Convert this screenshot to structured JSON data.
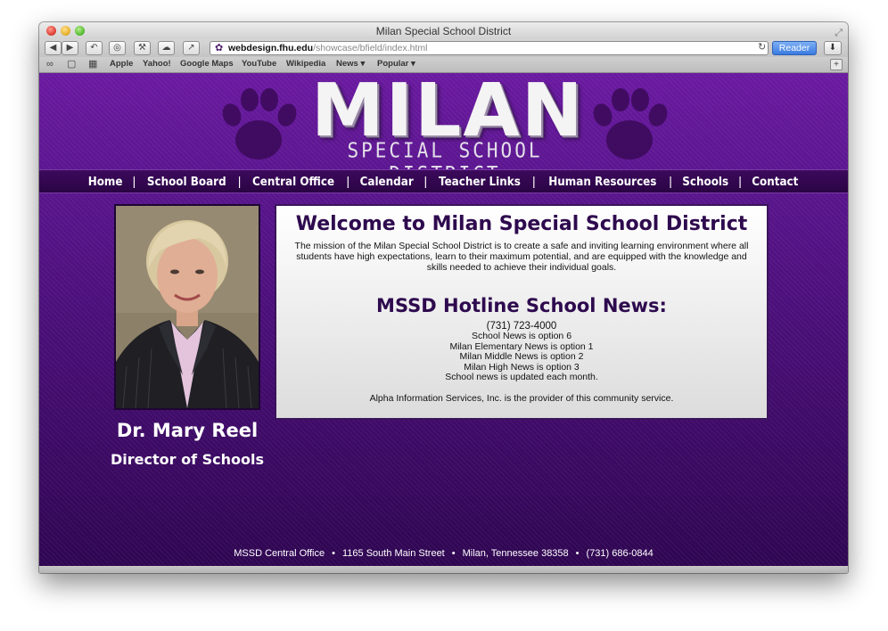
{
  "window": {
    "title": "Milan Special School District"
  },
  "toolbar": {
    "url_host": "webdesign.fhu.edu",
    "url_path": "/showcase/bfield/index.html",
    "reader_label": "Reader"
  },
  "bookmarks": {
    "items": [
      "Apple",
      "Yahoo!",
      "Google Maps",
      "YouTube",
      "Wikipedia",
      "News ▾",
      "Popular ▾"
    ]
  },
  "logo": {
    "main": "MILAN",
    "sub": "SPECIAL SCHOOL DISTRICT"
  },
  "nav": {
    "items": [
      "Home",
      "School Board",
      "Central Office",
      "Calendar",
      "Teacher Links",
      "Human Resources",
      "Schools",
      "Contact"
    ],
    "separator": "|"
  },
  "director": {
    "name": "Dr. Mary Reel",
    "role": "Director of Schools"
  },
  "content": {
    "welcome": "Welcome to Milan Special School District",
    "mission": "The mission of the Milan Special School District is to create a safe and inviting learning environment where all students have high expectations, learn to their maximum potential, and are equipped with the knowledge and skills needed to achieve their individual goals.",
    "hotline_title": "MSSD Hotline School News:",
    "hotline_lines": [
      "(731) 723-4000",
      "School News is option 6",
      "Milan Elementary News is option 1",
      "Milan Middle News is option 2",
      "Milan High News is option 3",
      "School news is updated each month."
    ],
    "provider": "Alpha Information Services, Inc. is the provider of this community service."
  },
  "footer": {
    "parts": [
      "MSSD Central Office",
      "1165 South Main Street",
      "Milan, Tennessee 38358",
      "(731) 686-0844"
    ],
    "bullet": "•"
  },
  "colors": {
    "page_purple": "#5c1690",
    "nav_bar": "#2a0444",
    "heading_purple": "#2e0a4e",
    "reader_blue": "#3a7ae0"
  },
  "icons": [
    "back-icon",
    "forward-icon",
    "history-icon",
    "topsites-icon",
    "tools-icon",
    "icloud-icon",
    "share-icon",
    "paw-favicon-icon",
    "reload-icon",
    "downloads-icon",
    "reading-list-icon",
    "bookmarks-book-icon",
    "grid-icon",
    "paw-print-icon"
  ]
}
